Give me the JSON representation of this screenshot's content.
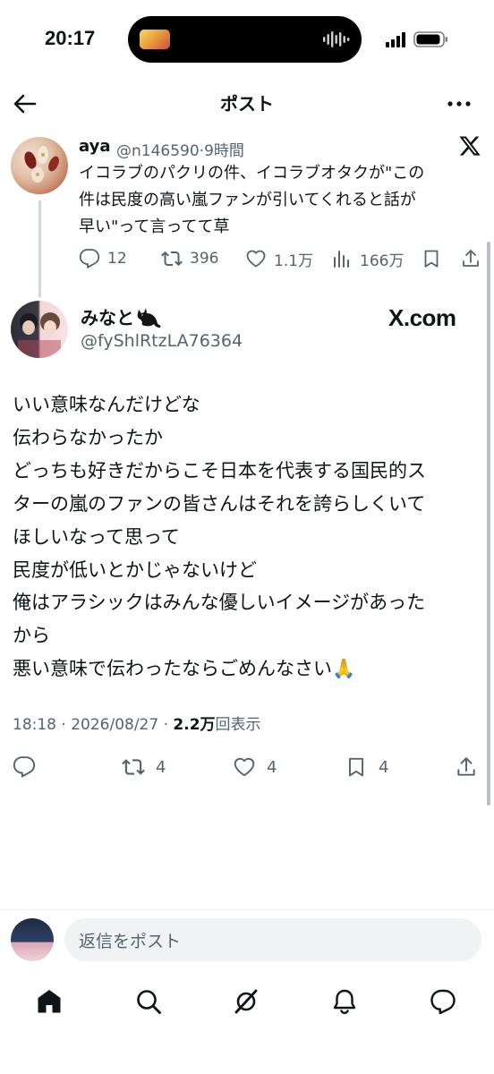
{
  "status_bar": {
    "time": "20:17"
  },
  "header": {
    "title": "ポスト",
    "back_icon": "arrow-left-icon",
    "more_icon": "more-horizontal-icon"
  },
  "quoted_post": {
    "name": "aya",
    "handle_time": "@n146590·9時間",
    "lines": [
      "イコラブのパクリの件、イコラブオタクが\"この",
      "件は民度の高い嵐ファンが引いてくれると話が",
      "早い\"って言ってて草"
    ],
    "actions": {
      "replies": "12",
      "reposts": "396",
      "likes": "1.1万",
      "views": "166万"
    }
  },
  "main_post": {
    "name": "みなと",
    "handle": "@fyShlRtzLA76364",
    "source_logo": "X.com",
    "lines": [
      "いい意味なんだけどな",
      "伝わらなかったか",
      "どっちも好きだからこそ日本を代表する国民的ス",
      "ターの嵐のファンの皆さんはそれを誇らしくいて",
      "ほしいなって思って",
      "民度が低いとかじゃないけど",
      "俺はアラシックはみんな優しいイメージがあった",
      "から",
      "悪い意味で伝わったならごめんなさい🙏"
    ],
    "timestamp": "18:18 · 2026/08/27 · ",
    "views_count": "2.2万",
    "views_label": "回表示",
    "actions": {
      "replies": "",
      "reposts": "4",
      "likes": "4",
      "bookmarks": "4"
    }
  },
  "reply_bar": {
    "placeholder": "返信をポスト"
  },
  "bottom_nav": [
    "home-icon",
    "search-icon",
    "grok-icon",
    "notifications-icon",
    "messages-icon"
  ],
  "colors": {
    "text": "#0f1419",
    "secondary": "#536471",
    "divider": "#eff3f4"
  }
}
